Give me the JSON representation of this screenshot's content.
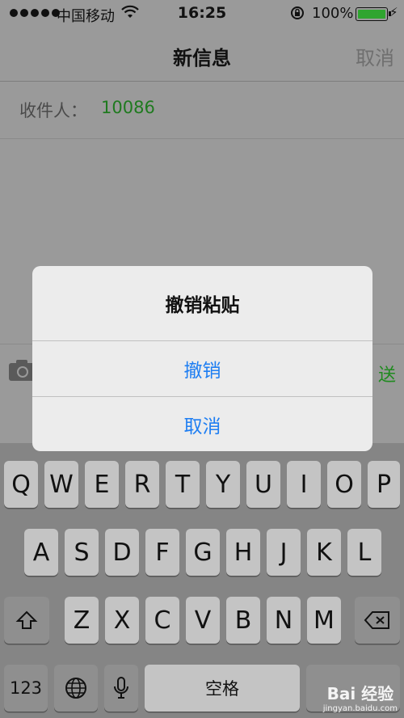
{
  "status_bar": {
    "carrier": "中国移动",
    "time": "16:25",
    "battery": "100%",
    "signal_icon": "signal-dots-icon",
    "wifi_icon": "wifi-icon",
    "lock_icon": "rotation-lock-icon",
    "battery_icon": "battery-icon",
    "battery_level": 1.0,
    "battery_color": "#2fa52f"
  },
  "nav": {
    "title": "新信息",
    "cancel": "取消"
  },
  "recipient": {
    "label": "收件人：",
    "value": "10086",
    "value_color": "#1f7a1f"
  },
  "compose": {
    "camera_icon": "camera-icon",
    "send": "送"
  },
  "alert": {
    "title": "撤销粘贴",
    "undo": "撤销",
    "cancel": "取消",
    "accent": "#1e7ef2"
  },
  "keyboard": {
    "row1": [
      "Q",
      "W",
      "E",
      "R",
      "T",
      "Y",
      "U",
      "I",
      "O",
      "P"
    ],
    "row2": [
      "A",
      "S",
      "D",
      "F",
      "G",
      "H",
      "J",
      "K",
      "L"
    ],
    "row3": [
      "Z",
      "X",
      "C",
      "V",
      "B",
      "N",
      "M"
    ],
    "num": "123",
    "space": "空格",
    "shift_icon": "shift-icon",
    "delete_icon": "backspace-icon",
    "globe_icon": "globe-icon",
    "mic_icon": "microphone-icon"
  },
  "watermark": {
    "main": "Bai 经验",
    "sub": "jingyan.baidu.com"
  }
}
